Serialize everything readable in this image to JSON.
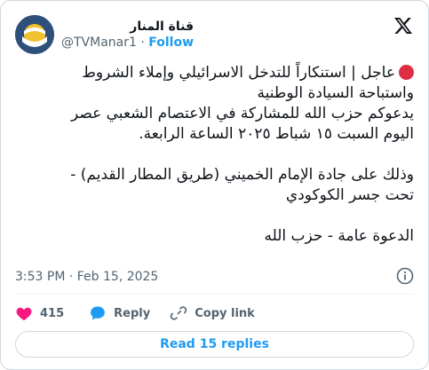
{
  "author": {
    "name": "قناة المنار",
    "handle": "@TVManar1",
    "separator": "·",
    "follow_label": "Follow"
  },
  "tweet": {
    "lines": [
      "عاجل | استنكاراً للتدخل الاسرائيلي وإملاء الشروط",
      "واستباحة السيادة الوطنية",
      "يدعوكم حزب الله للمشاركة في الاعتصام الشعبي عصر",
      "اليوم السبت ١٥ شباط ٢٠٢٥ الساعة الرابعة.",
      "",
      "وذلك على جادة الإمام الخميني (طريق المطار القديم) -",
      "تحت جسر الكوكودي",
      "",
      "الدعوة عامة - حزب الله"
    ]
  },
  "timestamp": "3:53 PM · Feb 15, 2025",
  "actions": {
    "like_count": "415",
    "reply_label": "Reply",
    "copy_link_label": "Copy link"
  },
  "read_replies_label": "Read 15 replies",
  "colors": {
    "accent": "#1d9bf0",
    "like": "#f91880",
    "breaking_dot": "#dd2e44"
  }
}
